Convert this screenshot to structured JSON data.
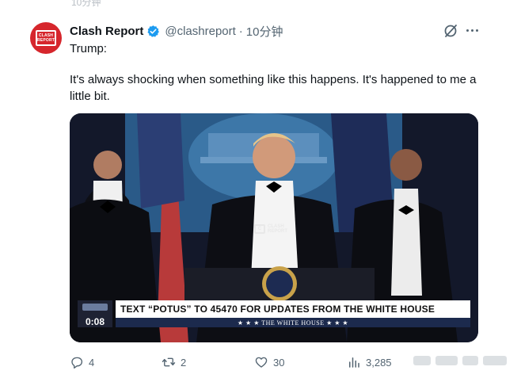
{
  "top_sliver": "10分钟",
  "post": {
    "avatar_text_1": "CLASH",
    "avatar_text_2": "REPORT",
    "author_name": "Clash Report",
    "handle": "@clashreport",
    "separator": "·",
    "time": "10分钟",
    "text_line_1": "Trump:",
    "text_line_2": "It's always shocking when something like this happens. It's happened to me a little bit."
  },
  "media": {
    "watermark_1": "CLASH",
    "watermark_2": "REPORT",
    "ticker": "TEXT “POTUS” TO 45470 FOR UPDATES FROM THE WHITE HOUSE",
    "ticker_sub": "★ ★ ★  THE WHITE HOUSE  ★ ★ ★",
    "duration": "0:08"
  },
  "actions": {
    "replies": "4",
    "reposts": "2",
    "likes": "30",
    "views": "3,285"
  },
  "colors": {
    "accent_verified": "#1d9bf0",
    "avatar_bg": "#d6262c",
    "muted_text": "#536471"
  },
  "icons": [
    "verified-badge-icon",
    "grok-icon",
    "more-icon",
    "reply-icon",
    "repost-icon",
    "like-icon",
    "views-icon"
  ]
}
